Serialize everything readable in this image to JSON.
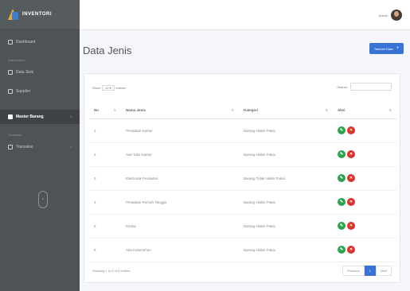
{
  "sidebar": {
    "brand": "INVENTORI",
    "items": [
      {
        "label": "Dashboard",
        "type": "item"
      },
      {
        "label": "Data Master",
        "type": "head"
      },
      {
        "label": "Data Stok",
        "type": "item"
      },
      {
        "label": "Supplier",
        "type": "item"
      },
      {
        "label": "Master Barang",
        "type": "item",
        "active": true,
        "caret": "›"
      },
      {
        "label": "Transaksi",
        "type": "head"
      },
      {
        "label": "Transaksi",
        "type": "item",
        "caret": "›"
      }
    ],
    "toggle": "‹"
  },
  "topbar": {
    "user_name": "Admin"
  },
  "header": {
    "title": "Data Jenis",
    "add_label": "Tambah Data",
    "add_icon": "+"
  },
  "table_controls": {
    "show_label": "Show",
    "entries_value": "10",
    "entries_label": "entries",
    "search_label": "Search:"
  },
  "table": {
    "columns": [
      "No",
      "Nama Jenis",
      "Kategori",
      "Aksi"
    ],
    "rows": [
      [
        "1",
        "Peralatan Kantor",
        "Barang Habis Pakai"
      ],
      [
        "2",
        "Alat Tulis Kantor",
        "Barang Habis Pakai"
      ],
      [
        "3",
        "Elektronik Peralatan",
        "Barang Tidak Habis Pakai"
      ],
      [
        "4",
        "Peralatan Rumah Tangga",
        "Barang Habis Pakai"
      ],
      [
        "5",
        "Kertas",
        "Barang Habis Pakai"
      ],
      [
        "6",
        "Alat Kebersihan",
        "Barang Habis Pakai"
      ]
    ]
  },
  "footer": {
    "info": "Showing 1 to 6 of 6 entries",
    "prev": "Previous",
    "page": "1",
    "next": "Next"
  },
  "colors": {
    "accent": "#3973d6",
    "sidebar": "#4e5358",
    "edit": "#2ea44f",
    "delete": "#d9342b"
  }
}
